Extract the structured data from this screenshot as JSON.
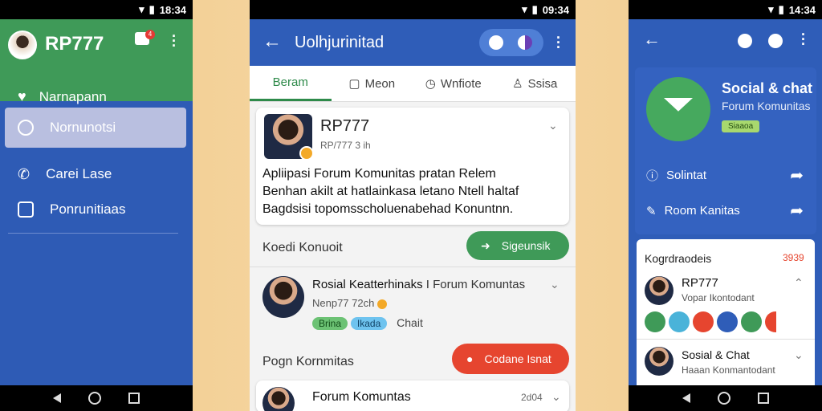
{
  "phone1": {
    "status": {
      "time": "18:34"
    },
    "app_name": "RP777",
    "badge_count": "4",
    "header_item": "Narnapann",
    "menu": [
      {
        "label": "Nornunotsi",
        "icon": "search-icon",
        "active": true
      },
      {
        "label": "Carei Lase",
        "icon": "phone-icon",
        "active": false
      },
      {
        "label": "Ponrunitiaas",
        "icon": "inbox-icon",
        "active": false
      }
    ]
  },
  "phone2": {
    "status": {
      "time": "09:34"
    },
    "title": "Uolhjurinitad",
    "tabs": [
      {
        "label": "Beram",
        "icon": "",
        "selected": true
      },
      {
        "label": "Meon",
        "icon": "chat-icon",
        "selected": false
      },
      {
        "label": "Wnfiote",
        "icon": "clock-icon",
        "selected": false
      },
      {
        "label": "Ssisa",
        "icon": "person-icon",
        "selected": false
      }
    ],
    "post": {
      "author": "RP777",
      "handle": "RP/777 3 ih",
      "body_lines": [
        "Apliipasi Forum Komunitas pratan Relem",
        "Benhan akilt at hatlainkasa letano Ntell haltaf",
        "Bagdsisi topomsscholuenabehad Konuntnn."
      ]
    },
    "section1": {
      "label": "Koedi Konuoit",
      "button": "Sigeunsik"
    },
    "item1": {
      "title": "Rosial Keatterhinaks",
      "subtitle": "I Forum Komuntas",
      "handle": "Nenp77 72ch",
      "tags": [
        "Brina",
        "Ikada"
      ],
      "extra": "Chait"
    },
    "section2": {
      "label": "Pogn Kornmitas",
      "button": "Codane Isnat"
    },
    "item2": {
      "title": "Forum Komuntas",
      "meta": "2d04"
    }
  },
  "phone3": {
    "status": {
      "time": "14:34"
    },
    "hero": {
      "title": "Social & chat",
      "subtitle": "Forum Komunitas",
      "badge": "Siaaoa",
      "rows": [
        {
          "label": "Solintat",
          "icon": "info-icon"
        },
        {
          "label": "Room Kanitas",
          "icon": "edit-icon"
        }
      ]
    },
    "panel": {
      "heading": "Kogrdraodeis",
      "heading_value": "3939",
      "entries": [
        {
          "title": "RP777",
          "subtitle": "Vopar Ikontodant"
        },
        {
          "title": "Sosial & Chat",
          "subtitle": "Haaan Konmantodant"
        }
      ]
    },
    "colors": [
      "#3f9a58",
      "#4ab3d9",
      "#e6452f",
      "#2f5db8",
      "#3f9a58",
      "#e6452f"
    ]
  },
  "colors": {
    "brand_blue": "#2f5db8",
    "brand_green": "#3f9a58",
    "accent_red": "#e6452f"
  }
}
